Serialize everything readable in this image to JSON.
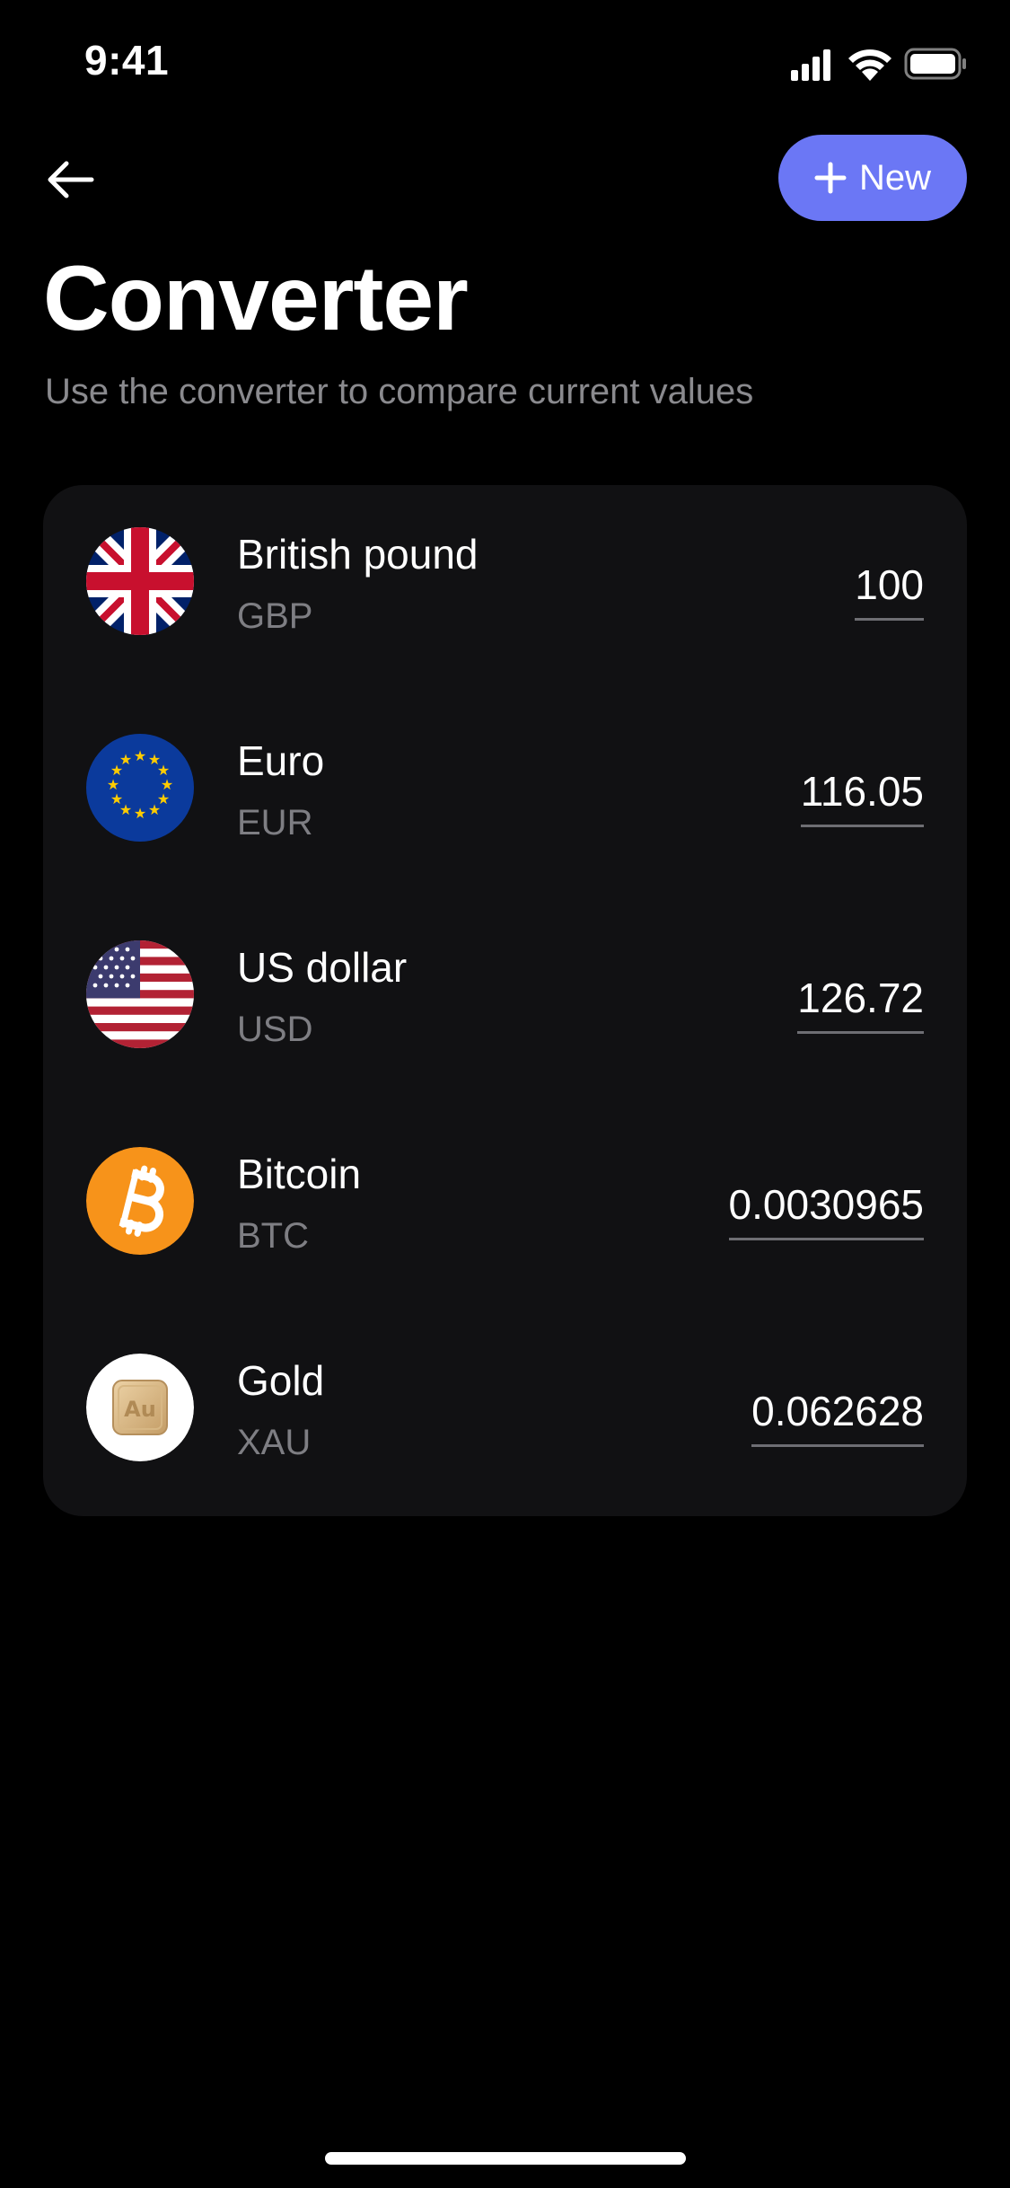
{
  "status_bar": {
    "time": "9:41"
  },
  "header": {
    "new_label": "New",
    "title": "Converter",
    "subtitle": "Use the converter to compare current values"
  },
  "colors": {
    "accent": "#6b77f5",
    "card_bg": "#111113",
    "muted_text": "#8a8a8e"
  },
  "currencies": [
    {
      "name": "British pound",
      "code": "GBP",
      "value": "100",
      "icon": "uk-flag-icon"
    },
    {
      "name": "Euro",
      "code": "EUR",
      "value": "116.05",
      "icon": "eu-flag-icon"
    },
    {
      "name": "US dollar",
      "code": "USD",
      "value": "126.72",
      "icon": "us-flag-icon"
    },
    {
      "name": "Bitcoin",
      "code": "BTC",
      "value": "0.0030965",
      "icon": "bitcoin-icon"
    },
    {
      "name": "Gold",
      "code": "XAU",
      "value": "0.062628",
      "icon": "gold-bar-icon",
      "icon_text": "Au"
    }
  ]
}
